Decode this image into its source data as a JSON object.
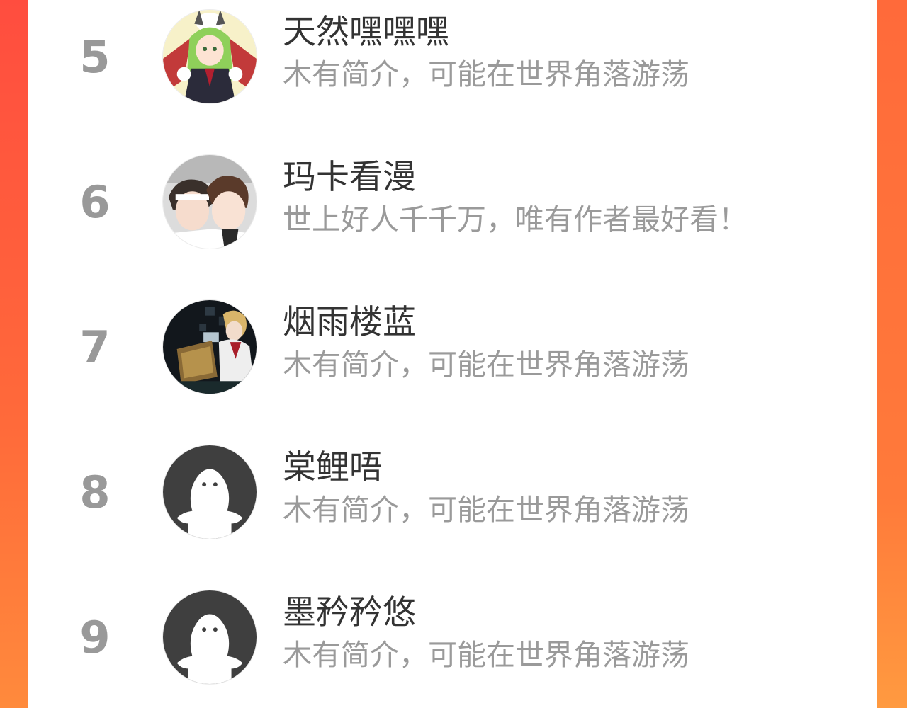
{
  "ranking": {
    "items": [
      {
        "rank": "5",
        "name": "天然嘿嘿嘿",
        "bio": "木有简介，可能在世界角落游荡",
        "avatar": "illustrated-demon-girl-avatar"
      },
      {
        "rank": "6",
        "name": "玛卡看漫",
        "bio": "世上好人千千万，唯有作者最好看！",
        "avatar": "illustrated-two-boys-avatar"
      },
      {
        "rank": "7",
        "name": "烟雨楼蓝",
        "bio": "木有简介，可能在世界角落游荡",
        "avatar": "illustrated-dark-scene-avatar"
      },
      {
        "rank": "8",
        "name": "棠鲤唔",
        "bio": "木有简介，可能在世界角落游荡",
        "avatar": "default-ghost-avatar"
      },
      {
        "rank": "9",
        "name": "墨矜矜悠",
        "bio": "木有简介，可能在世界角落游荡",
        "avatar": "default-ghost-avatar"
      }
    ]
  },
  "colors": {
    "background_accent": "#ff5a3c",
    "rank_text": "#999999",
    "name_text": "#333333",
    "bio_text": "#9a9a9a",
    "default_avatar_bg": "#3f3f3f"
  }
}
